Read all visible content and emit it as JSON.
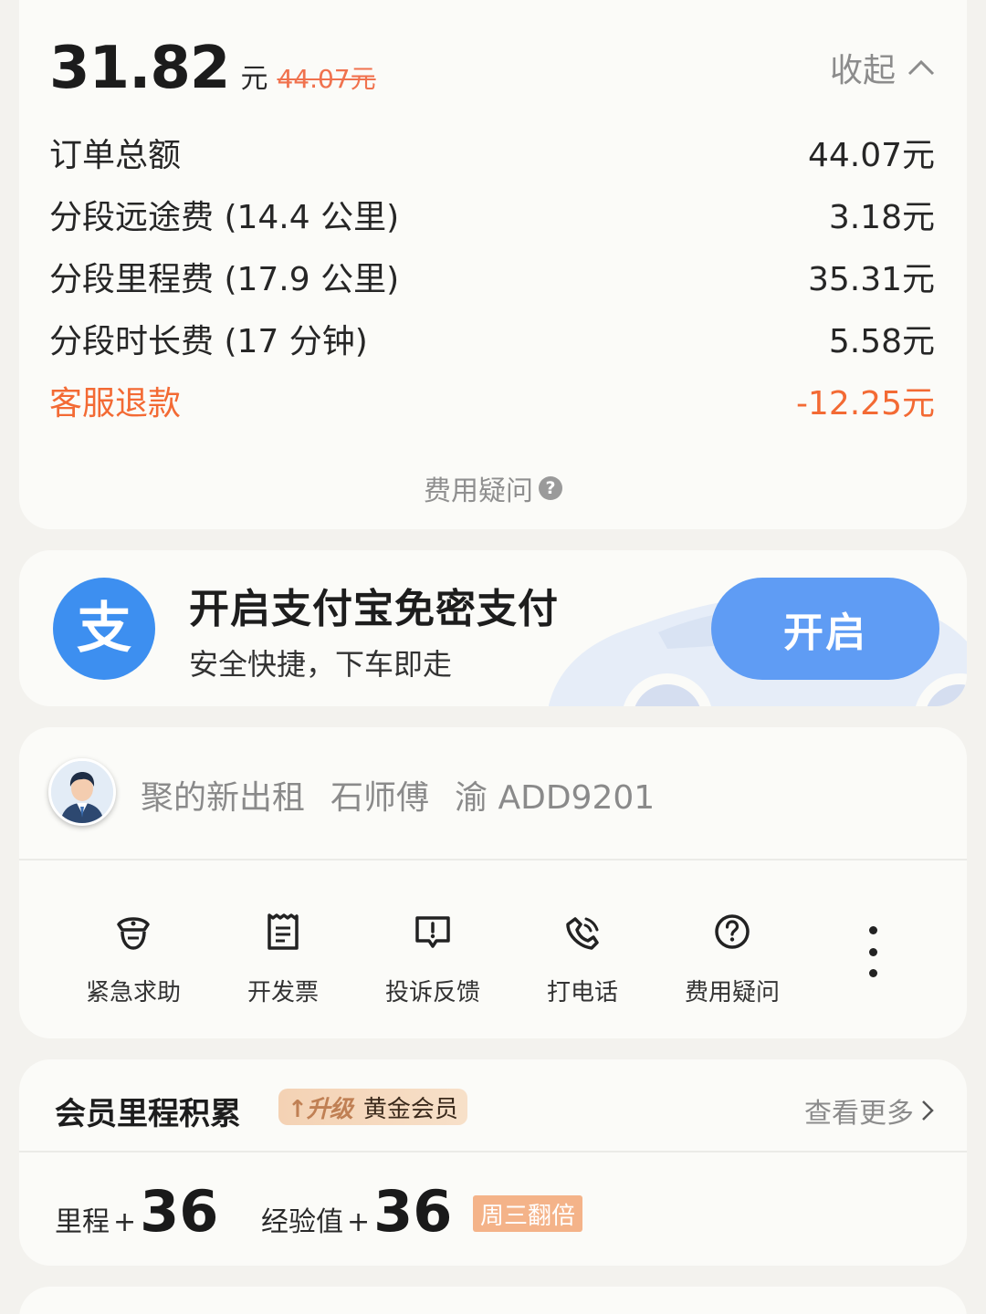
{
  "fare": {
    "total": "31.82",
    "unit": "元",
    "original": "44.07元",
    "collapse_label": "收起",
    "items": [
      {
        "label": "订单总额",
        "value": "44.07元"
      },
      {
        "label": "分段远途费 (14.4 公里)",
        "value": "3.18元"
      },
      {
        "label": "分段里程费 (17.9 公里)",
        "value": "35.31元"
      },
      {
        "label": "分段时长费 (17 分钟)",
        "value": "5.58元"
      },
      {
        "label": "客服退款",
        "value": "-12.25元"
      }
    ],
    "help_label": "费用疑问",
    "help_icon": "question-circle-icon"
  },
  "alipay": {
    "logo_glyph": "支",
    "title": "开启支付宝免密支付",
    "subtitle": "安全快捷，下车即走",
    "button_label": "开启",
    "color": "#3d8ff0"
  },
  "driver": {
    "company": "聚的新出租",
    "name": "石师傅",
    "plate": "渝 ADD9201"
  },
  "actions": [
    {
      "label": "紧急求助",
      "icon": "police-badge-icon"
    },
    {
      "label": "开发票",
      "icon": "receipt-icon"
    },
    {
      "label": "投诉反馈",
      "icon": "alert-message-icon"
    },
    {
      "label": "打电话",
      "icon": "phone-icon"
    },
    {
      "label": "费用疑问",
      "icon": "question-circle-icon"
    }
  ],
  "member": {
    "title": "会员里程积累",
    "badge_up": "升级",
    "badge_level": "黄金会员",
    "see_more": "查看更多",
    "mileage_label": "里程",
    "mileage_value": "36",
    "exp_label": "经验值",
    "exp_value": "36",
    "plus": "+",
    "promo": "周三翻倍"
  },
  "colors": {
    "accent_orange": "#f36a34",
    "alipay_blue": "#3d8ff0",
    "button_blue": "#5f9cf4"
  }
}
